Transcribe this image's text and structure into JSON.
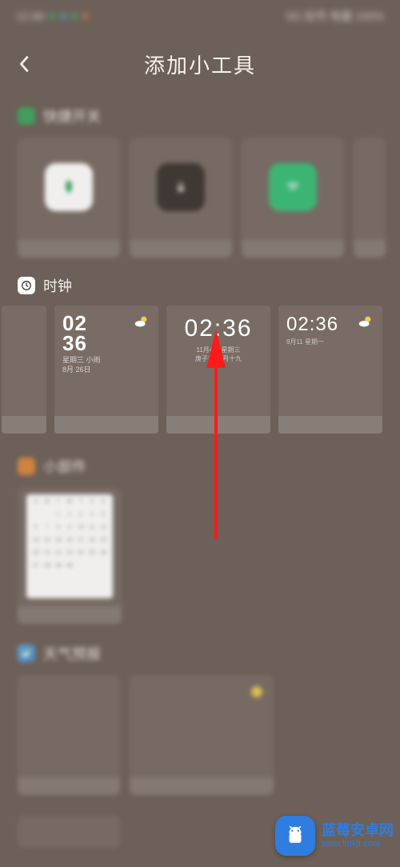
{
  "status": {
    "time": "12:48",
    "right": "5G 信号 电量 100%"
  },
  "header": {
    "title": "添加小工具"
  },
  "sections": {
    "s1": {
      "label": "快捷开关"
    },
    "clock": {
      "label": "时钟"
    },
    "s3": {
      "label": "小部件"
    },
    "s4": {
      "label": "天气预报"
    }
  },
  "clock_widgets": {
    "w1": {
      "time_line1": "02",
      "time_line2": "36",
      "sub1": "星期三 小雨",
      "sub2": "8月 26日"
    },
    "w2": {
      "time": "02:36",
      "sub1": "11月4日 星期三",
      "sub2": "庚子年 九月十九"
    },
    "w3": {
      "time": "02:36",
      "sub": "9月11 星期一"
    }
  },
  "watermark": {
    "title": "蓝莓安卓网",
    "url": "www.lmkjt.com"
  }
}
